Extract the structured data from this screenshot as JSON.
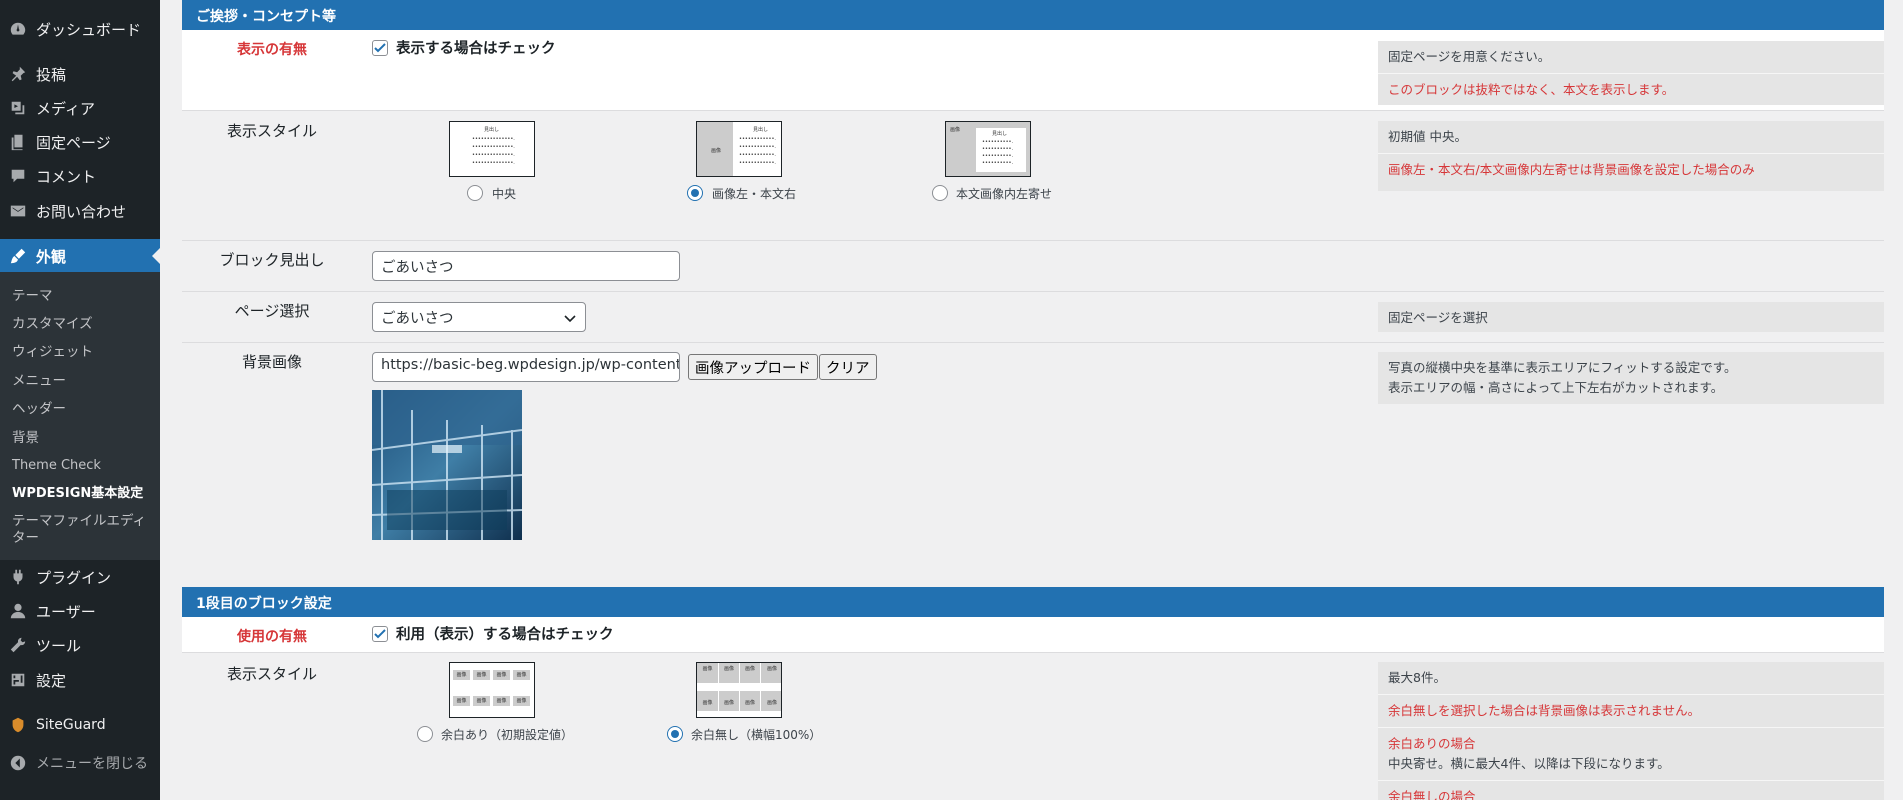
{
  "sidebar": {
    "items": [
      {
        "label": "ダッシュボード",
        "icon": "dashboard-icon"
      },
      {
        "label": "投稿",
        "icon": "pushpin-icon"
      },
      {
        "label": "メディア",
        "icon": "media-icon"
      },
      {
        "label": "固定ページ",
        "icon": "page-icon"
      },
      {
        "label": "コメント",
        "icon": "comment-icon"
      },
      {
        "label": "お問い合わせ",
        "icon": "mail-icon"
      },
      {
        "label": "外観",
        "icon": "brush-icon"
      },
      {
        "label": "プラグイン",
        "icon": "plugin-icon"
      },
      {
        "label": "ユーザー",
        "icon": "user-icon"
      },
      {
        "label": "ツール",
        "icon": "wrench-icon"
      },
      {
        "label": "設定",
        "icon": "settings-icon"
      },
      {
        "label": "SiteGuard",
        "icon": "siteguard-icon"
      },
      {
        "label": "メニューを閉じる",
        "icon": "collapse-icon"
      }
    ],
    "submenu": [
      "テーマ",
      "カスタマイズ",
      "ウィジェット",
      "メニュー",
      "ヘッダー",
      "背景",
      "Theme Check",
      "WPDESIGN基本設定",
      "テーマファイルエディター"
    ]
  },
  "section1": {
    "title": "ご挨拶・コンセプト等",
    "visibility": {
      "label": "表示の有無",
      "checkbox_label": "表示する場合はチェック",
      "note1": "固定ページを用意ください。",
      "note2": "このブロックは抜粋ではなく、本文を表示します。"
    },
    "style": {
      "label": "表示スタイル",
      "options": [
        "中央",
        "画像左・本文右",
        "本文画像内左寄せ"
      ],
      "note1": "初期値 中央。",
      "note2": "画像左・本文右/本文画像内左寄せは背景画像を設定した場合のみ",
      "thumb_heading": "見出し",
      "thumb_image": "画像"
    },
    "heading": {
      "label": "ブロック見出し",
      "value": "ごあいさつ"
    },
    "page_select": {
      "label": "ページ選択",
      "value": "ごあいさつ",
      "note": "固定ページを選択"
    },
    "bg_image": {
      "label": "背景画像",
      "url": "https://basic-beg.wpdesign.jp/wp-content",
      "upload_label": "画像アップロード",
      "clear_label": "クリア",
      "note1": "写真の縦横中央を基準に表示エリアにフィットする設定です。",
      "note2": "表示エリアの幅・高さによって上下左右がカットされます。"
    }
  },
  "section2": {
    "title": "1段目のブロック設定",
    "usage": {
      "label": "使用の有無",
      "checkbox_label": "利用（表示）する場合はチェック"
    },
    "style": {
      "label": "表示スタイル",
      "options": [
        "余白あり（初期設定値）",
        "余白無し（横幅100%）"
      ],
      "cell_left": "画像",
      "cell_right": "画像",
      "note1": "最大8件。",
      "note2": "余白無しを選択した場合は背景画像は表示されません。",
      "note3": "余白ありの場合",
      "note4": "中央寄せ。横に最大4件、以降は下段になります。",
      "note5": "余白無しの場合"
    }
  },
  "colors": {
    "accent": "#2271b1",
    "sidebar": "#1d2327",
    "red": "#d63638"
  }
}
